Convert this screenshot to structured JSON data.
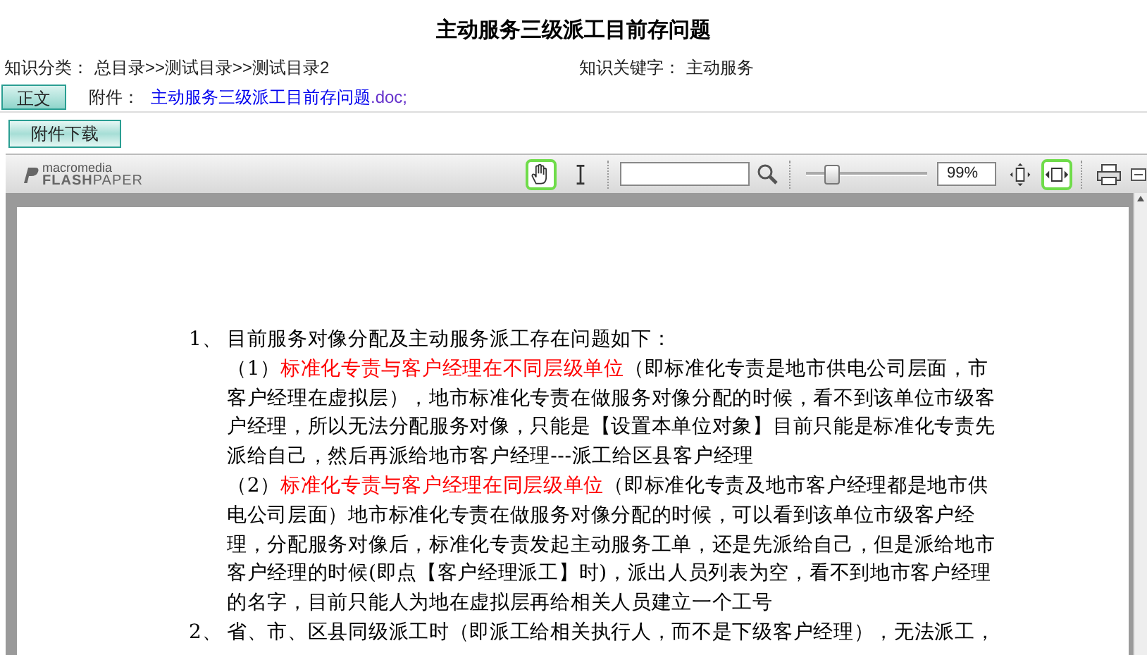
{
  "title": "主动服务三级派工目前存问题",
  "meta": [
    {
      "label": "知识分类：",
      "value": "总目录>>测试目录>>测试目录2"
    },
    {
      "label": "知识关键字：",
      "value": "主动服务"
    }
  ],
  "body_button": "正文",
  "attachment": {
    "label": "附件：",
    "name": "主动服务三级派工目前存问题",
    "ext": ".doc;"
  },
  "download_button": "附件下载",
  "viewer": {
    "logo": {
      "top": "macromedia",
      "brand": "FLASH",
      "brand_rest": "PAPER"
    },
    "tools": [
      {
        "kind": "hand",
        "selected": true
      },
      {
        "kind": "text-select",
        "selected": false
      }
    ],
    "zoom": {
      "level": 0.2,
      "reading": "99%"
    },
    "fit_tools": [
      {
        "kind": "fit-page",
        "selected": false
      },
      {
        "kind": "fit-width",
        "selected": true
      }
    ],
    "document": [
      {
        "kind": "item",
        "number": "1、",
        "segments": [
          {
            "text": "目前服务对像分配及主动服务派工存在问题如下：",
            "highlighted": false
          }
        ]
      },
      {
        "kind": "sub",
        "segments": [
          {
            "text": "（1）",
            "highlighted": false
          },
          {
            "text": "标准化专责与客户经理在不同层级单位",
            "highlighted": true
          },
          {
            "text": "（即标准化专责是地市供电公司层面，市客户经理在虚拟层），地市标准化专责在做服务对像分配的时候，看不到该单位市级客户经理，所以无法分配服务对像，只能是【设置本单位对象】目前只能是标准化专责先派给自己，然后再派给地市客户经理---派工给区县客户经理",
            "highlighted": false
          }
        ]
      },
      {
        "kind": "sub",
        "segments": [
          {
            "text": "（2）",
            "highlighted": false
          },
          {
            "text": "标准化专责与客户经理在同层级单位",
            "highlighted": true
          },
          {
            "text": "（即标准化专责及地市客户经理都是地市供电公司层面）地市标准化专责在做服务对像分配的时候，可以看到该单位市级客户经理，分配服务对像后，标准化专责发起主动服务工单，还是先派给自己，但是派给地市客户经理的时候(即点【客户经理派工】时)，派出人员列表为空，看不到地市客户经理的名字，目前只能人为地在虚拟层再给相关人员建立一个工号",
            "highlighted": false
          }
        ]
      },
      {
        "kind": "item",
        "number": "2、",
        "segments": [
          {
            "text": "省、市、区县同级派工时（即派工给相关执行人，而不是下级客户经理），无法派工，",
            "highlighted": false
          }
        ]
      }
    ]
  }
}
